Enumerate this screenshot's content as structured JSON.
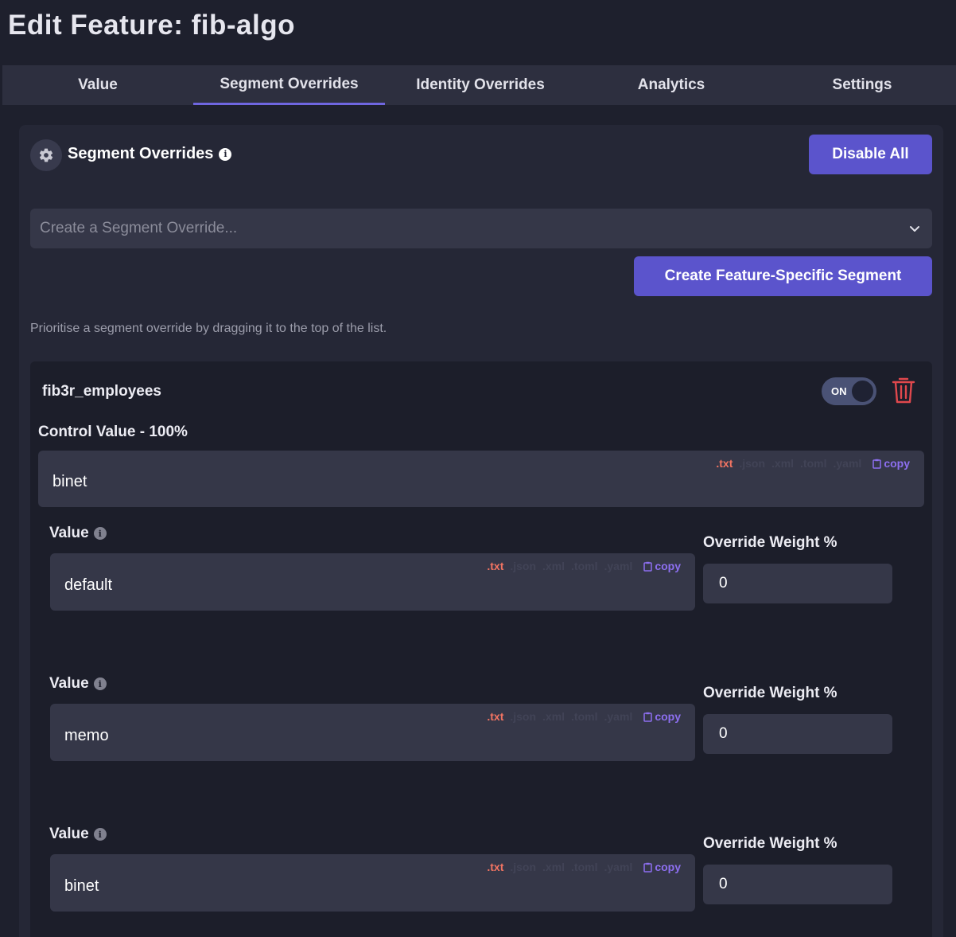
{
  "page": {
    "title": "Edit Feature: fib-algo"
  },
  "tabs": [
    {
      "label": "Value",
      "active": false
    },
    {
      "label": "Segment Overrides",
      "active": true
    },
    {
      "label": "Identity Overrides",
      "active": false
    },
    {
      "label": "Analytics",
      "active": false
    },
    {
      "label": "Settings",
      "active": false
    }
  ],
  "panel": {
    "title": "Segment Overrides",
    "disable_all_label": "Disable All",
    "select_placeholder": "Create a Segment Override...",
    "create_segment_label": "Create Feature-Specific Segment",
    "hint": "Prioritise a segment override by dragging it to the top of the list."
  },
  "segment": {
    "name": "fib3r_employees",
    "toggle_label": "ON",
    "enabled": true,
    "control_label": "Control Value - 100%",
    "control_value": "binet",
    "formats": [
      ".txt",
      ".json",
      ".xml",
      ".toml",
      ".yaml"
    ],
    "active_format": ".txt",
    "copy_label": "copy",
    "variations": [
      {
        "value_label": "Value",
        "value": "default",
        "weight_label": "Override Weight %",
        "weight": "0"
      },
      {
        "value_label": "Value",
        "value": "memo",
        "weight_label": "Override Weight %",
        "weight": "0"
      },
      {
        "value_label": "Value",
        "value": "binet",
        "weight_label": "Override Weight %",
        "weight": "0"
      }
    ]
  },
  "colors": {
    "accent": "#5b54cc",
    "tab_underline": "#6f66e0",
    "format_active": "#f27462",
    "copy": "#8d6ff0",
    "delete": "#e0484d"
  }
}
